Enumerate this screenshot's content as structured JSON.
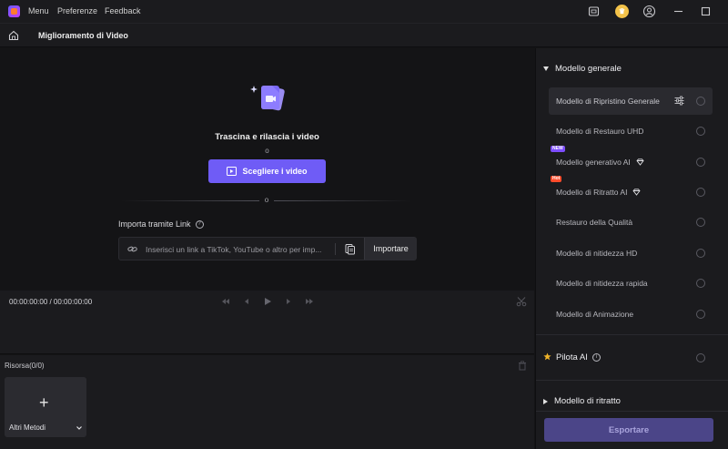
{
  "titlebar": {
    "menu_items": [
      "Menu",
      "Preferenze",
      "Feedback"
    ]
  },
  "subheader": {
    "title": "Miglioramento di Video"
  },
  "dropzone": {
    "title": "Trascina e rilascia i video",
    "or_text": "o",
    "choose_button": "Scegliere i video",
    "divider_or": "o",
    "import_label": "Importa tramite Link",
    "link_placeholder": "Inserisci un link a TikTok, YouTube o altro per imp...",
    "import_button": "Importare"
  },
  "player": {
    "timecode": "00:00:00:00 / 00:00:00:00"
  },
  "resources": {
    "label": "Risorsa(0/0)",
    "add_label": "Altri Metodi"
  },
  "rightpanel": {
    "general_model_header": "Modello generale",
    "models": [
      {
        "label": "Modello di Ripristino Generale",
        "tag": "",
        "diamond": false,
        "selected": true
      },
      {
        "label": "Modello di Restauro UHD",
        "tag": "",
        "diamond": false,
        "selected": false
      },
      {
        "label": "Modello generativo AI",
        "tag": "NEW",
        "diamond": true,
        "selected": false
      },
      {
        "label": "Modello di Ritratto AI",
        "tag": "Hot",
        "diamond": true,
        "selected": false
      },
      {
        "label": "Restauro della Qualità",
        "tag": "",
        "diamond": false,
        "selected": false
      },
      {
        "label": "Modello di nitidezza HD",
        "tag": "",
        "diamond": false,
        "selected": false
      },
      {
        "label": "Modello di nitidezza rapida",
        "tag": "",
        "diamond": false,
        "selected": false
      },
      {
        "label": "Modello di Animazione",
        "tag": "",
        "diamond": false,
        "selected": false
      }
    ],
    "ai_pilot": "Pilota AI",
    "portrait_model_header": "Modello di ritratto",
    "export_button": "Esportare"
  },
  "colors": {
    "accent": "#6f5cf6",
    "export_disabled": "#4b4588",
    "background": "#141416",
    "panel": "#1b1b1e"
  }
}
